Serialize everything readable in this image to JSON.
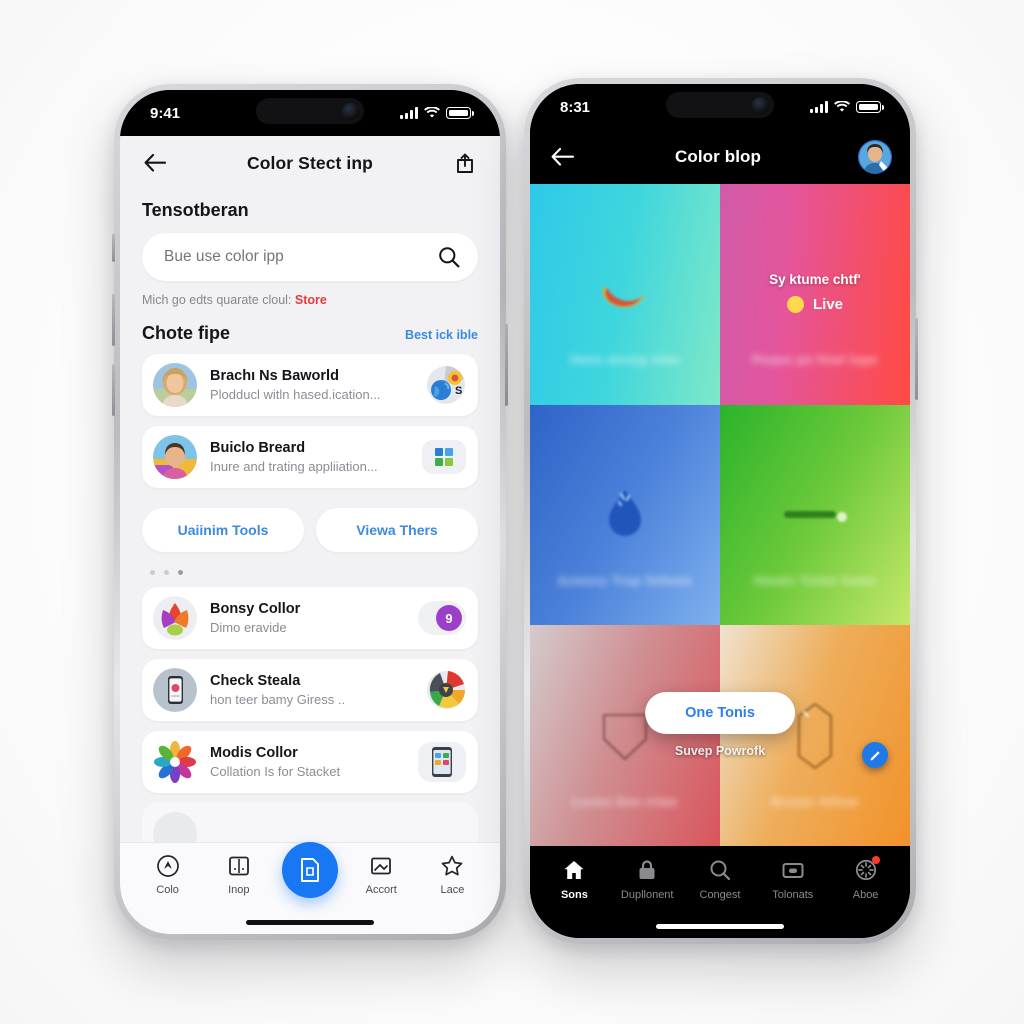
{
  "left_phone": {
    "status": {
      "time": "9:41",
      "signal_icon": "cellular-bars-icon",
      "wifi_icon": "wifi-icon",
      "battery_icon": "battery-icon"
    },
    "navbar": {
      "back_icon": "back-arrow-icon",
      "title": "Color Stect inp",
      "action_icon": "share-upload-icon"
    },
    "section_label": "Tensotberan",
    "search": {
      "placeholder": "Bue use color ipp",
      "value": "",
      "icon": "search-icon"
    },
    "note": {
      "text": "Mich go edts quarate cloul:",
      "link": "Store"
    },
    "section": {
      "title": "Chote fipe",
      "link": "Best ick ible"
    },
    "cards_top": [
      {
        "title": "Brachı Ns Baworld",
        "subtitle": "Plodducl witln hased.ication...",
        "avatar": "woman-portrait-avatar",
        "trailing_icon": "globe-chat-badge-icon"
      },
      {
        "title": "Buiclo Breard",
        "subtitle": "Inure and trating appliiation...",
        "avatar": "child-portrait-avatar",
        "trailing_icon": "grid-squares-icon"
      }
    ],
    "buttons": [
      {
        "label": "Uaiinim Tools",
        "icon": "tools-button"
      },
      {
        "label": "Viewa Thers",
        "icon": "view-others-button"
      }
    ],
    "page_dots": {
      "count": 3,
      "active_index": 2
    },
    "cards_bottom": [
      {
        "title": "Bonsy Collor",
        "subtitle": "Dimo eravide",
        "avatar": "colorful-petals-avatar",
        "trailing_icon": "purple-circle-badge-icon"
      },
      {
        "title": "Check Steala",
        "subtitle": "hon teer bamy Giress  ..",
        "avatar": "phone-device-avatar",
        "trailing_icon": "color-wheel-icon"
      },
      {
        "title": "Modis Collor",
        "subtitle": "Collation Is for Stacket",
        "avatar": "rainbow-flower-avatar",
        "trailing_icon": "app-screen-icon"
      }
    ],
    "tabbar": [
      {
        "label": "Colo",
        "icon": "compass-circle-icon"
      },
      {
        "label": "Inop",
        "icon": "book-open-icon"
      },
      {
        "label": "",
        "icon": "document-scan-fab-icon"
      },
      {
        "label": "Accort",
        "icon": "image-arrow-icon"
      },
      {
        "label": "Lace",
        "icon": "star-outline-icon"
      }
    ]
  },
  "right_phone": {
    "status": {
      "time": "8:31",
      "signal_icon": "cellular-bars-icon",
      "wifi_icon": "wifi-icon",
      "battery_icon": "battery-icon"
    },
    "navbar": {
      "back_icon": "back-arrow-icon",
      "title": "Color blop",
      "avatar": "profile-avatar"
    },
    "grid_cells": [
      {
        "caption": "Hens atviop bibe",
        "icon": "banana-crescent-blob",
        "color_from": "#2ec9e8",
        "color_to": "#7fe8c8"
      },
      {
        "caption": "Poaes pn finel lupe",
        "icon": "live-badge",
        "color_from": "#e4559c",
        "color_to": "#ff4a42",
        "live": {
          "title": "Sy ktume chtf'",
          "label": "Live",
          "dot_color": "#ffd84d"
        }
      },
      {
        "caption": "Azmory Trop fellows",
        "icon": "water-drop-blob",
        "color_from": "#2f63c8",
        "color_to": "#7fb0ee"
      },
      {
        "caption": "Hmaln Tinlot Swim",
        "icon": "green-line-blob",
        "color_from": "#2bb32b",
        "color_to": "#c6e86a"
      },
      {
        "caption": "Luves tlon rriwe",
        "icon": "shield-outline-blob",
        "color_from": "#c8c0c4",
        "color_to": "#d9555c"
      },
      {
        "caption": "Brzzac fellow",
        "icon": "hexagon-outline-blob",
        "color_from": "#e8dccb",
        "color_to": "#f2922a"
      }
    ],
    "overlay": {
      "cta_label": "One Tonis",
      "sub_label": "Suvep Powrofk",
      "fab_icon": "edit-pencil-icon"
    },
    "tabbar": [
      {
        "label": "Sons",
        "icon": "home-icon",
        "active": true,
        "badge": false
      },
      {
        "label": "Dupllonent",
        "icon": "lock-icon",
        "active": false,
        "badge": false
      },
      {
        "label": "Congest",
        "icon": "search-icon",
        "active": false,
        "badge": false
      },
      {
        "label": "Tolonats",
        "icon": "camera-icon",
        "active": false,
        "badge": false
      },
      {
        "label": "Aboe",
        "icon": "compass-icon",
        "active": false,
        "badge": true
      }
    ]
  },
  "colors": {
    "accent_blue": "#1877f2",
    "link_blue": "#3b8ae0",
    "alert_red": "#e23b3b",
    "light_bg": "#f2f2f5",
    "dark_bg": "#000000",
    "badge_red": "#ff3b30"
  }
}
